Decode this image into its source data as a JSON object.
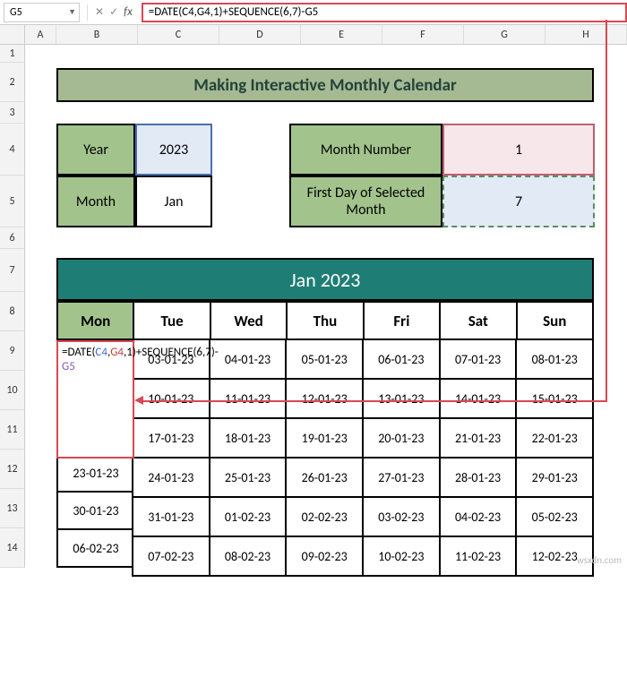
{
  "name_box": "G5",
  "formula": "=DATE(C4,G4,1)+SEQUENCE(6,7)-G5",
  "columns": [
    "A",
    "B",
    "C",
    "D",
    "E",
    "F",
    "G",
    "H"
  ],
  "rows": [
    "1",
    "2",
    "3",
    "4",
    "5",
    "6",
    "7",
    "8",
    "9",
    "10",
    "11",
    "12",
    "13",
    "14"
  ],
  "banner": "Making Interactive Monthly Calendar",
  "labels": {
    "year": "Year",
    "year_val": "2023",
    "month": "Month",
    "month_val": "Jan",
    "month_num": "Month Number",
    "month_num_val": "1",
    "first_day": "First Day of Selected Month",
    "first_day_val": "7"
  },
  "cal_title": "Jan 2023",
  "cal_headers": [
    "Mon",
    "Tue",
    "Wed",
    "Thu",
    "Fri",
    "Sat",
    "Sun"
  ],
  "cal_left": [
    "",
    "",
    "",
    "23-01-23",
    "30-01-23",
    "06-02-23"
  ],
  "cal_rows": [
    [
      "03-01-23",
      "04-01-23",
      "05-01-23",
      "06-01-23",
      "07-01-23",
      "08-01-23"
    ],
    [
      "10-01-23",
      "11-01-23",
      "12-01-23",
      "13-01-23",
      "14-01-23",
      "15-01-23"
    ],
    [
      "17-01-23",
      "18-01-23",
      "19-01-23",
      "20-01-23",
      "21-01-23",
      "22-01-23"
    ],
    [
      "24-01-23",
      "25-01-23",
      "26-01-23",
      "27-01-23",
      "28-01-23",
      "29-01-23"
    ],
    [
      "31-01-23",
      "01-02-23",
      "02-02-23",
      "03-02-23",
      "04-02-23",
      "05-02-23"
    ],
    [
      "07-02-23",
      "08-02-23",
      "09-02-23",
      "10-02-23",
      "11-02-23",
      "12-02-23"
    ]
  ],
  "overlay_parts": {
    "p1": "=DATE(",
    "c4": "C4",
    "comma1": ",",
    "g4": "G4",
    "p2": ",1)+",
    "seq": "SEQUENCE(6,7)-",
    "g5": "G5"
  },
  "watermark": "wsxdn.com",
  "chart_data": {
    "type": "table",
    "title": "Jan 2023",
    "columns": [
      "Mon",
      "Tue",
      "Wed",
      "Thu",
      "Fri",
      "Sat",
      "Sun"
    ],
    "rows": [
      [
        "",
        "03-01-23",
        "04-01-23",
        "05-01-23",
        "06-01-23",
        "07-01-23",
        "08-01-23"
      ],
      [
        "",
        "10-01-23",
        "11-01-23",
        "12-01-23",
        "13-01-23",
        "14-01-23",
        "15-01-23"
      ],
      [
        "",
        "17-01-23",
        "18-01-23",
        "19-01-23",
        "20-01-23",
        "21-01-23",
        "22-01-23"
      ],
      [
        "23-01-23",
        "24-01-23",
        "25-01-23",
        "26-01-23",
        "27-01-23",
        "28-01-23",
        "29-01-23"
      ],
      [
        "30-01-23",
        "31-01-23",
        "01-02-23",
        "02-02-23",
        "03-02-23",
        "04-02-23",
        "05-02-23"
      ],
      [
        "06-02-23",
        "07-02-23",
        "08-02-23",
        "09-02-23",
        "10-02-23",
        "11-02-23",
        "12-02-23"
      ]
    ]
  }
}
